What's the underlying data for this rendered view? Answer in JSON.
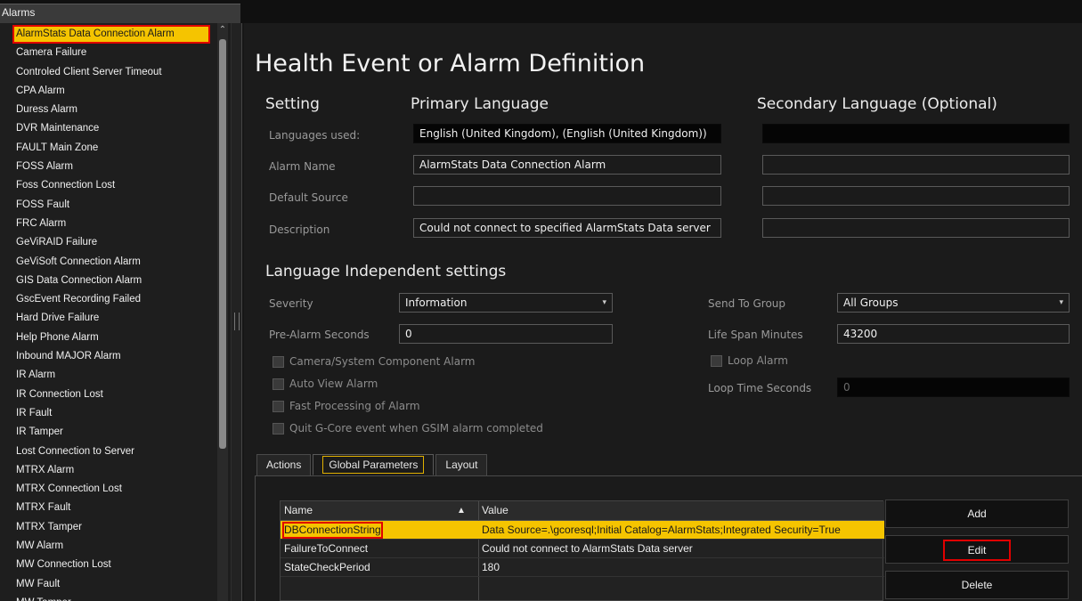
{
  "window": {
    "title": "Alarms"
  },
  "sidebar": {
    "items": [
      "AlarmStats Data Connection Alarm",
      "Camera Failure",
      "Controled Client Server Timeout",
      "CPA Alarm",
      "Duress Alarm",
      "DVR Maintenance",
      "FAULT Main Zone",
      "FOSS Alarm",
      "Foss Connection Lost",
      "FOSS Fault",
      "FRC Alarm",
      "GeViRAID Failure",
      "GeViSoft Connection Alarm",
      "GIS Data Connection Alarm",
      "GscEvent Recording Failed",
      "Hard Drive Failure",
      "Help Phone Alarm",
      "Inbound MAJOR Alarm",
      "IR Alarm",
      "IR Connection Lost",
      "IR Fault",
      "IR Tamper",
      "Lost Connection to Server",
      "MTRX Alarm",
      "MTRX Connection Lost",
      "MTRX Fault",
      "MTRX Tamper",
      "MW Alarm",
      "MW Connection Lost",
      "MW Fault",
      "MW Tamper"
    ],
    "selected_index": 0
  },
  "main": {
    "title": "Health Event or Alarm Definition",
    "headers": {
      "setting": "Setting",
      "primary": "Primary Language",
      "secondary": "Secondary Language (Optional)"
    },
    "fields": {
      "languages_label": "Languages used:",
      "languages_primary": "English (United Kingdom), (English (United Kingdom))",
      "languages_secondary": "",
      "alarm_name_label": "Alarm Name",
      "alarm_name_primary": "AlarmStats Data Connection Alarm",
      "alarm_name_secondary": "",
      "default_source_label": "Default Source",
      "default_source_primary": "",
      "default_source_secondary": "",
      "description_label": "Description",
      "description_primary": "Could not connect to specified AlarmStats Data server",
      "description_secondary": ""
    },
    "independent": {
      "heading": "Language Independent settings",
      "severity_label": "Severity",
      "severity_value": "Information",
      "pre_alarm_label": "Pre-Alarm Seconds",
      "pre_alarm_value": "0",
      "send_group_label": "Send To Group",
      "send_group_value": "All Groups",
      "life_span_label": "Life Span Minutes",
      "life_span_value": "43200",
      "loop_alarm_label": "Loop Alarm",
      "loop_time_label": "Loop Time Seconds",
      "loop_time_value": "0",
      "checkboxes": [
        {
          "label": "Camera/System Component Alarm",
          "checked": false
        },
        {
          "label": "Auto View Alarm",
          "checked": false
        },
        {
          "label": "Fast Processing of Alarm",
          "checked": false
        },
        {
          "label": "Quit G-Core event when GSIM alarm completed",
          "checked": false
        }
      ]
    },
    "tabs": [
      {
        "label": "Actions",
        "active": false
      },
      {
        "label": "Global Parameters",
        "active": true
      },
      {
        "label": "Layout",
        "active": false
      }
    ],
    "params": {
      "col_name": "Name",
      "col_value": "Value",
      "sort_indicator": "▲",
      "rows": [
        {
          "name": "DBConnectionString",
          "value": "Data Source=.\\gcoresql;Initial Catalog=AlarmStats;Integrated Security=True",
          "selected": true
        },
        {
          "name": "FailureToConnect",
          "value": "Could not connect to AlarmStats Data server",
          "selected": false
        },
        {
          "name": "StateCheckPeriod",
          "value": "180",
          "selected": false
        }
      ]
    },
    "buttons": {
      "add": "Add",
      "edit": "Edit",
      "delete": "Delete"
    }
  },
  "colors": {
    "selection": "#f5c400",
    "highlight_box": "#e00000",
    "background": "#1b1b1b"
  }
}
